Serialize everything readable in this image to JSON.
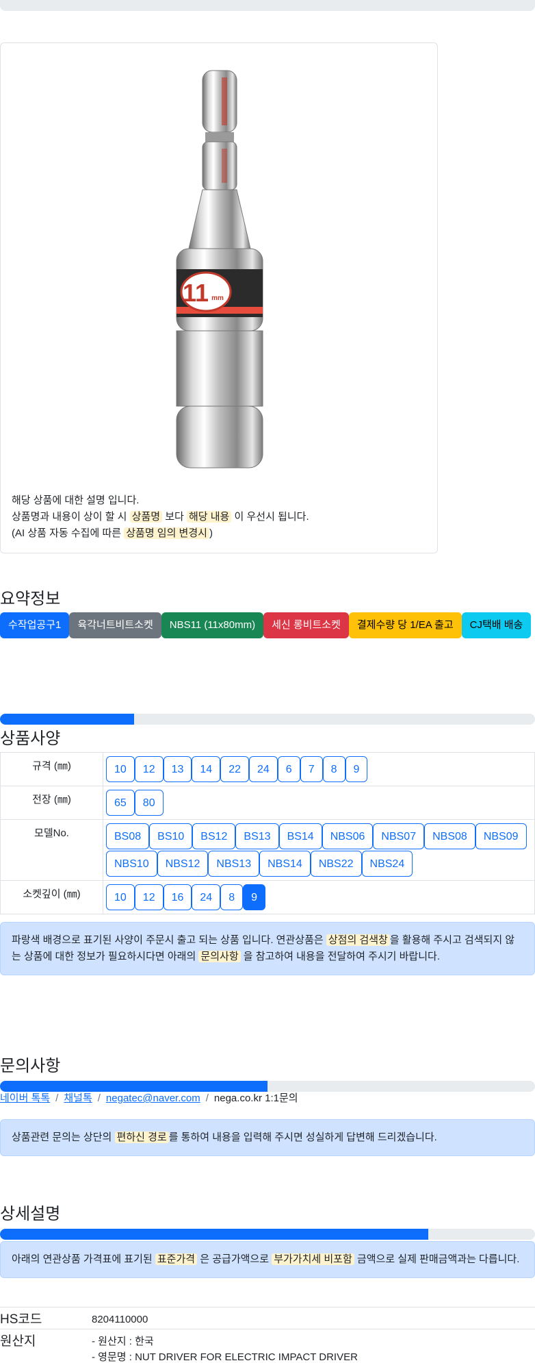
{
  "product_card": {
    "image_alt": "11mm nut driver socket",
    "image_label": "11",
    "image_unit": "mm",
    "line1": "해당 상품에 대한 설명 입니다.",
    "line2_a": "상품명과 내용이 상이 할 시 ",
    "line2_hl1": "상품명",
    "line2_b": " 보다 ",
    "line2_hl2": "해당 내용",
    "line2_c": " 이 우선시 됩니다.",
    "line3_a": "(AI 상품 자동 수집에 따른 ",
    "line3_hl": "상품명 임의 변경시",
    "line3_b": ")"
  },
  "summary": {
    "title": "요약정보",
    "badges": [
      "수작업공구1",
      "육각너트비트소켓",
      "NBS11 (11x80mm)",
      "세신 롱비트소켓",
      "결제수량 당 1/EA 출고",
      "CJ택배 배송"
    ]
  },
  "spec": {
    "title": "상품사양",
    "progress": 0.25,
    "rows": [
      {
        "label": "규격 (㎜)",
        "options": [
          "10",
          "12",
          "13",
          "14",
          "22",
          "24",
          "6",
          "7",
          "8",
          "9"
        ],
        "active": -1
      },
      {
        "label": "전장 (㎜)",
        "options": [
          "65",
          "80"
        ],
        "active": -1
      },
      {
        "label": "모델No.",
        "options": [
          "BS08",
          "BS10",
          "BS12",
          "BS13",
          "BS14",
          "NBS06",
          "NBS07",
          "NBS08",
          "NBS09",
          "NBS10",
          "NBS12",
          "NBS13",
          "NBS14",
          "NBS22",
          "NBS24"
        ],
        "active": -1
      },
      {
        "label": "소켓깊이 (㎜)",
        "options": [
          "10",
          "12",
          "16",
          "24",
          "8",
          "9"
        ],
        "active": 5
      }
    ],
    "notice_a": "파랑색 배경으로 표기된 사양이 주문시 출고 되는 상품 입니다. 연관상품은 ",
    "notice_hl1": "상점의 검색창",
    "notice_b": "을 활용해 주시고 검색되지 않는 상품에 대한 정보가 필요하시다면 아래의 ",
    "notice_hl2": "문의사항",
    "notice_c": " 을 참고하여 내용을 전달하여 주시기 바랍니다."
  },
  "inquiry": {
    "title": "문의사항",
    "progress": 0.5,
    "links": [
      "네이버 톡톡",
      "채널톡",
      "negatec@naver.com"
    ],
    "plain": "nega.co.kr 1:1문의",
    "sep": "/",
    "notice_a": "상품관련 문의는 상단의 ",
    "notice_hl": "편하신 경로",
    "notice_b": "를 통하여 내용을 입력해 주시면 성실하게 답변해 드리겠습니다."
  },
  "detail": {
    "title": "상세설명",
    "progress": 0.8,
    "notice_a": "아래의 연관상품 가격표에 표기된 ",
    "notice_hl1": "표준가격",
    "notice_b": " 은 공급가액으로 ",
    "notice_hl2": "부가가치세 비포함",
    "notice_c": " 금액으로 실제 판매금액과는 다릅니다.",
    "hs_label": "HS코드",
    "hs_value": "8204110000",
    "origin_label": "원산지",
    "origin_line1": "- 원산지 : 한국",
    "origin_line2": "- 영문명 : NUT DRIVER FOR ELECTRIC IMPACT DRIVER"
  },
  "colors": {
    "primary": "#0d6efd",
    "highlight": "#fff3cd",
    "alert_bg": "#cfe2ff"
  }
}
